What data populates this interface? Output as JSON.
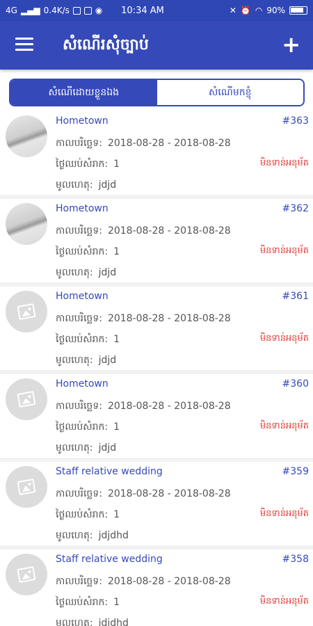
{
  "status_bar": {
    "network": "4G",
    "speed": "0.4K/s",
    "time": "10:34 AM",
    "battery": "90%"
  },
  "app_bar": {
    "title": "សំណើរសុំច្បាប់",
    "menu_icon": "menu-icon",
    "add_icon": "plus-icon"
  },
  "tabs": [
    {
      "label": "សំណើដោយខ្លួនឯង",
      "active": true
    },
    {
      "label": "សំណើមកខ្ញុំ",
      "active": false
    }
  ],
  "labels": {
    "period": "កាលបរិច្ឆេទ:",
    "days": "ថ្ងៃឈប់សំរាក:",
    "reason": "មូលហេតុ:"
  },
  "requests": [
    {
      "title": "Hometown",
      "number": "#363",
      "period": "2018-08-28 - 2018-08-28",
      "days": "1",
      "reason": "jdjd",
      "status": "មិនទាន់អនុម័ត",
      "avatar": "photo"
    },
    {
      "title": "Hometown",
      "number": "#362",
      "period": "2018-08-28 - 2018-08-28",
      "days": "1",
      "reason": "jdjd",
      "status": "មិនទាន់អនុម័ត",
      "avatar": "photo"
    },
    {
      "title": "Hometown",
      "number": "#361",
      "period": "2018-08-28 - 2018-08-28",
      "days": "1",
      "reason": "jdjd",
      "status": "មិនទាន់អនុម័ត",
      "avatar": "placeholder"
    },
    {
      "title": "Hometown",
      "number": "#360",
      "period": "2018-08-28 - 2018-08-28",
      "days": "1",
      "reason": "jdjd",
      "status": "មិនទាន់អនុម័ត",
      "avatar": "placeholder"
    },
    {
      "title": "Staff relative wedding",
      "number": "#359",
      "period": "2018-08-28 - 2018-08-28",
      "days": "1",
      "reason": "jdjdhd",
      "status": "មិនទាន់អនុម័ត",
      "avatar": "placeholder"
    },
    {
      "title": "Staff relative wedding",
      "number": "#358",
      "period": "2018-08-28 - 2018-08-28",
      "days": "1",
      "reason": "jdjdhd",
      "status": "មិនទាន់អនុម័ត",
      "avatar": "placeholder"
    }
  ],
  "colors": {
    "primary": "#3549b9",
    "status_pending": "#e53935"
  }
}
